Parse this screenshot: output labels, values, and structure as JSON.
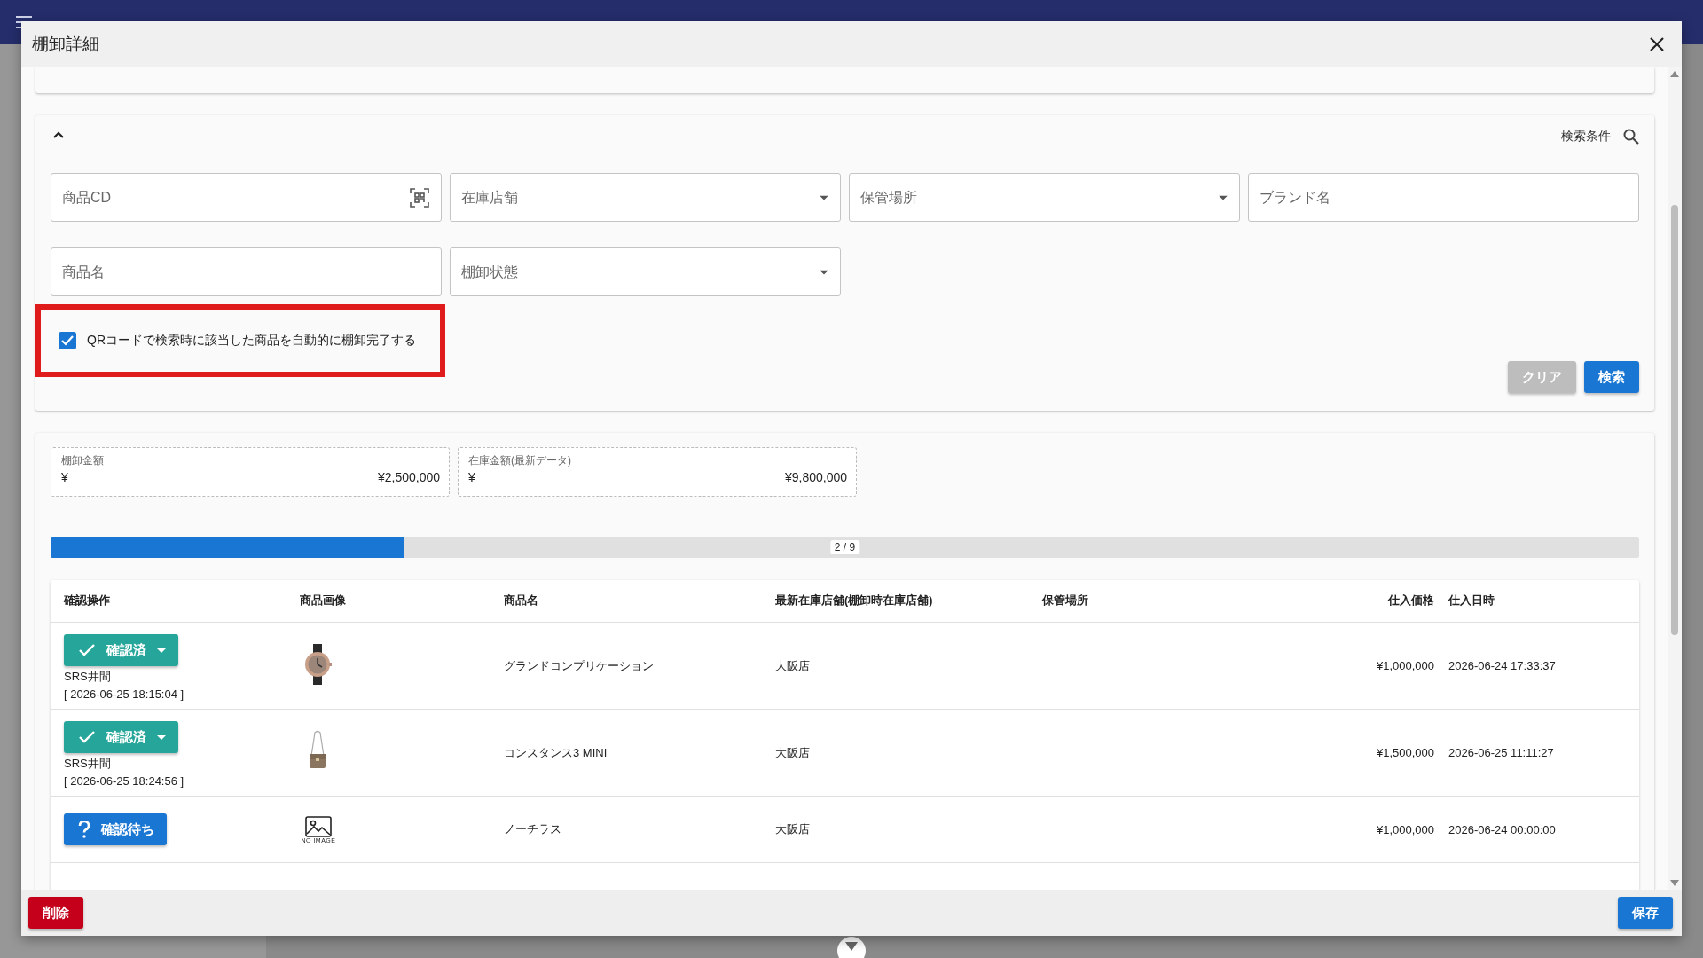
{
  "dialog": {
    "title": "棚卸詳細"
  },
  "search": {
    "expanded": true,
    "heading": "検索条件",
    "fields": [
      {
        "kind": "scan",
        "placeholder": "商品CD"
      },
      {
        "kind": "select",
        "placeholder": "在庫店舗"
      },
      {
        "kind": "select",
        "placeholder": "保管場所"
      },
      {
        "kind": "text",
        "placeholder": "ブランド名"
      },
      {
        "kind": "text",
        "placeholder": "商品名"
      },
      {
        "kind": "select",
        "placeholder": "棚卸状態"
      }
    ],
    "auto_complete": {
      "label": "QRコードで検索時に該当した商品を自動的に棚卸完了する",
      "checked": true,
      "highlighted": true
    },
    "buttons": [
      {
        "label": "クリア",
        "kind": "secondary"
      },
      {
        "label": "検索",
        "kind": "primary"
      }
    ]
  },
  "totals": [
    {
      "label": "棚卸金額",
      "currency": "¥",
      "value": "¥2,500,000"
    },
    {
      "label": "在庫金額(最新データ)",
      "currency": "¥",
      "value": "¥9,800,000"
    }
  ],
  "progress": {
    "level": 0.2222,
    "label": "2 / 9"
  },
  "table": {
    "columns": [
      "確認操作",
      "商品画像",
      "商品名",
      "最新在庫店舗(棚卸時在庫店舗)",
      "保管場所",
      "仕入価格",
      "仕入日時"
    ],
    "rows": [
      {
        "status": {
          "kind": "confirmed",
          "label": "確認済"
        },
        "confirmed_by": "SRS井間",
        "confirmed_at": "[ 2026-06-25 18:15:04 ]",
        "name": "グランドコンプリケーション",
        "store": "大阪店",
        "price": "¥1,000,000",
        "purchased_at": "2026-06-24 17:33:37"
      },
      {
        "status": {
          "kind": "confirmed",
          "label": "確認済"
        },
        "confirmed_by": "SRS井間",
        "confirmed_at": "[ 2026-06-25 18:24:56 ]",
        "name": "コンスタンス3 MINI",
        "store": "大阪店",
        "price": "¥1,500,000",
        "purchased_at": "2026-06-25 11:11:27"
      },
      {
        "status": {
          "kind": "pending",
          "label": "確認待ち"
        },
        "image": {
          "kind": "placeholder",
          "caption": "NO IMAGE"
        },
        "name": "ノーチラス",
        "store": "大阪店",
        "price": "¥1,000,000",
        "purchased_at": "2026-06-24 00:00:00"
      }
    ]
  },
  "footer": {
    "buttons": [
      {
        "label": "削除",
        "kind": "danger"
      },
      {
        "label": "保存",
        "kind": "primary"
      }
    ]
  }
}
